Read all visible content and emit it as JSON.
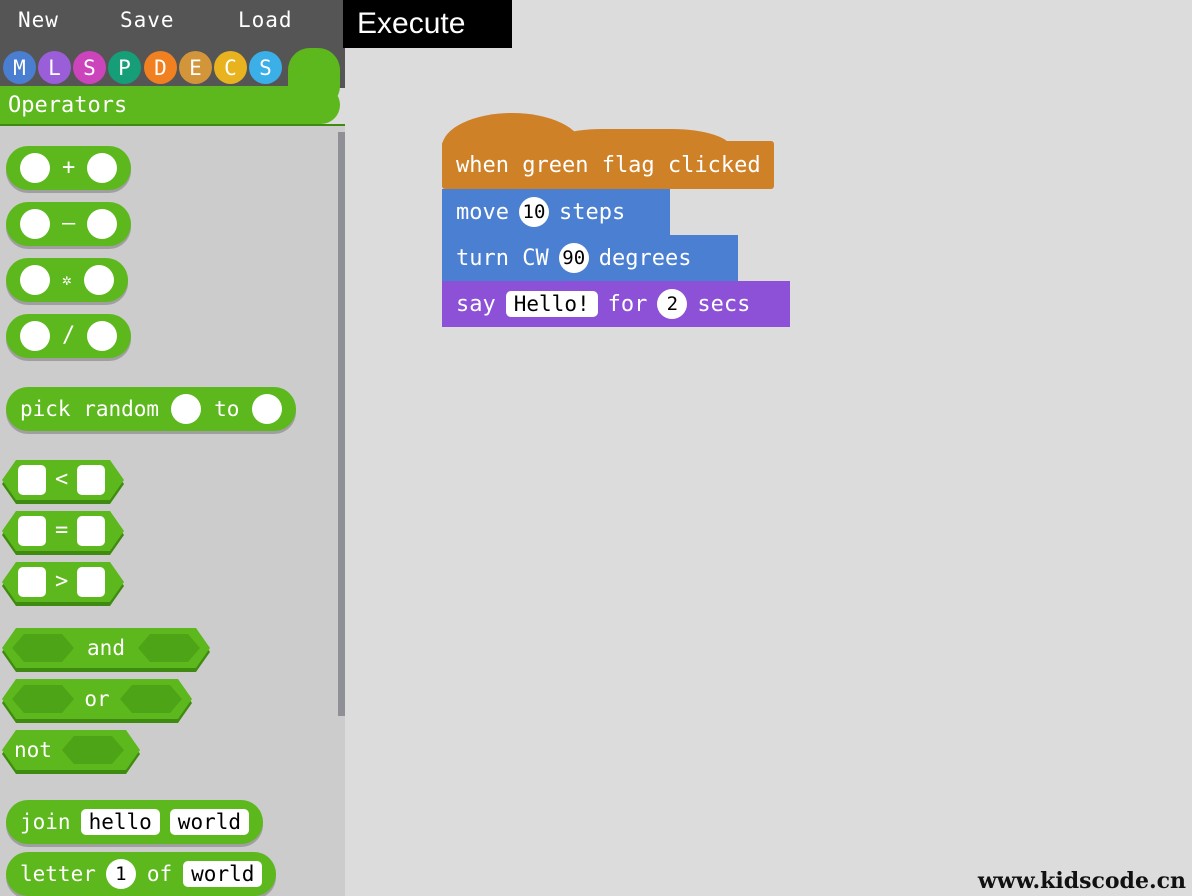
{
  "toolbar": {
    "new_label": "New",
    "save_label": "Save",
    "load_label": "Load",
    "execute_label": "Execute"
  },
  "categories": {
    "selected": "Operators",
    "title": "Operators",
    "items": [
      {
        "letter": "M",
        "name": "motion",
        "color": "#4a7ed1"
      },
      {
        "letter": "L",
        "name": "looks",
        "color": "#9a5fd8"
      },
      {
        "letter": "S",
        "name": "sound",
        "color": "#cc44bb"
      },
      {
        "letter": "P",
        "name": "pen",
        "color": "#159e78"
      },
      {
        "letter": "D",
        "name": "data",
        "color": "#f08020"
      },
      {
        "letter": "E",
        "name": "events",
        "color": "#d2953a"
      },
      {
        "letter": "C",
        "name": "control",
        "color": "#e8b31f"
      },
      {
        "letter": "S",
        "name": "sensing",
        "color": "#3aafe8"
      }
    ]
  },
  "palette": {
    "accent_color": "#5cb81c",
    "arithmetic": [
      {
        "symbol": "+",
        "name": "add"
      },
      {
        "symbol": "–",
        "name": "subtract"
      },
      {
        "symbol": "✲",
        "name": "multiply"
      },
      {
        "symbol": "/",
        "name": "divide"
      }
    ],
    "pick_random": {
      "prefix": "pick random",
      "middle": "to"
    },
    "comparisons": [
      {
        "symbol": "<",
        "name": "less-than"
      },
      {
        "symbol": "=",
        "name": "equals"
      },
      {
        "symbol": ">",
        "name": "greater-than"
      }
    ],
    "logic": [
      {
        "label": "and",
        "name": "and"
      },
      {
        "label": "or",
        "name": "or"
      }
    ],
    "not_block": {
      "label": "not"
    },
    "join_block": {
      "label": "join",
      "value1": "hello",
      "value2": "world"
    },
    "letter_block": {
      "prefix": "letter",
      "index": "1",
      "middle": "of",
      "value": "world"
    }
  },
  "script": {
    "blocks": [
      {
        "name": "when-green-flag-clicked",
        "type": "hat",
        "color": "#cf8127",
        "text": "when green flag clicked"
      },
      {
        "name": "move-steps",
        "type": "stack",
        "color": "#4a7fd1",
        "prefix": "move",
        "value": "10",
        "suffix": "steps"
      },
      {
        "name": "turn-cw-degrees",
        "type": "stack",
        "color": "#4a7fd1",
        "prefix": "turn CW",
        "value": "90",
        "suffix": "degrees"
      },
      {
        "name": "say-for-secs",
        "type": "stack",
        "color": "#8c51d6",
        "prefix": "say",
        "message": "Hello!",
        "middle": "for",
        "value": "2",
        "suffix": "secs"
      }
    ]
  },
  "watermark": "www.kidscode.cn"
}
